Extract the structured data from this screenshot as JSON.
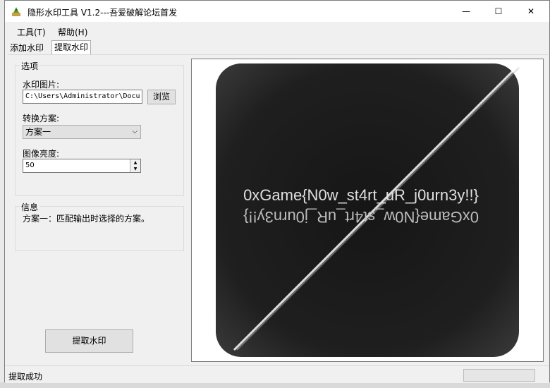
{
  "window": {
    "title": "隐形水印工具 V1.2---吾爱破解论坛首发",
    "minimize_glyph": "—",
    "maximize_glyph": "☐",
    "close_glyph": "✕"
  },
  "menu": {
    "tools": "工具(T)",
    "help": "帮助(H)"
  },
  "tabs": [
    {
      "label": "添加水印",
      "selected": false
    },
    {
      "label": "提取水印",
      "selected": true
    }
  ],
  "options": {
    "legend": "选项",
    "image_label": "水印图片:",
    "image_path": "C:\\Users\\Administrator\\Docu",
    "browse_button": "浏览",
    "scheme_label": "转换方案:",
    "scheme_value": "方案一",
    "brightness_label": "图像亮度:",
    "brightness_value": "50"
  },
  "info": {
    "legend": "信息",
    "text": "方案一：匹配输出时选择的方案。"
  },
  "extract_button": "提取水印",
  "preview": {
    "watermark_text": "0xGame{N0w_st4rt_uR_j0urn3y!!}",
    "watermark_text_mirrored": "0xGame{N0w_st4rt_uR_j0urn3y!!}"
  },
  "status": {
    "text": "提取成功"
  },
  "colors": {
    "window_bg": "#f0f0f0",
    "preview_dark": "#1a1a1a",
    "watermark_text": "#e0e0e0"
  }
}
